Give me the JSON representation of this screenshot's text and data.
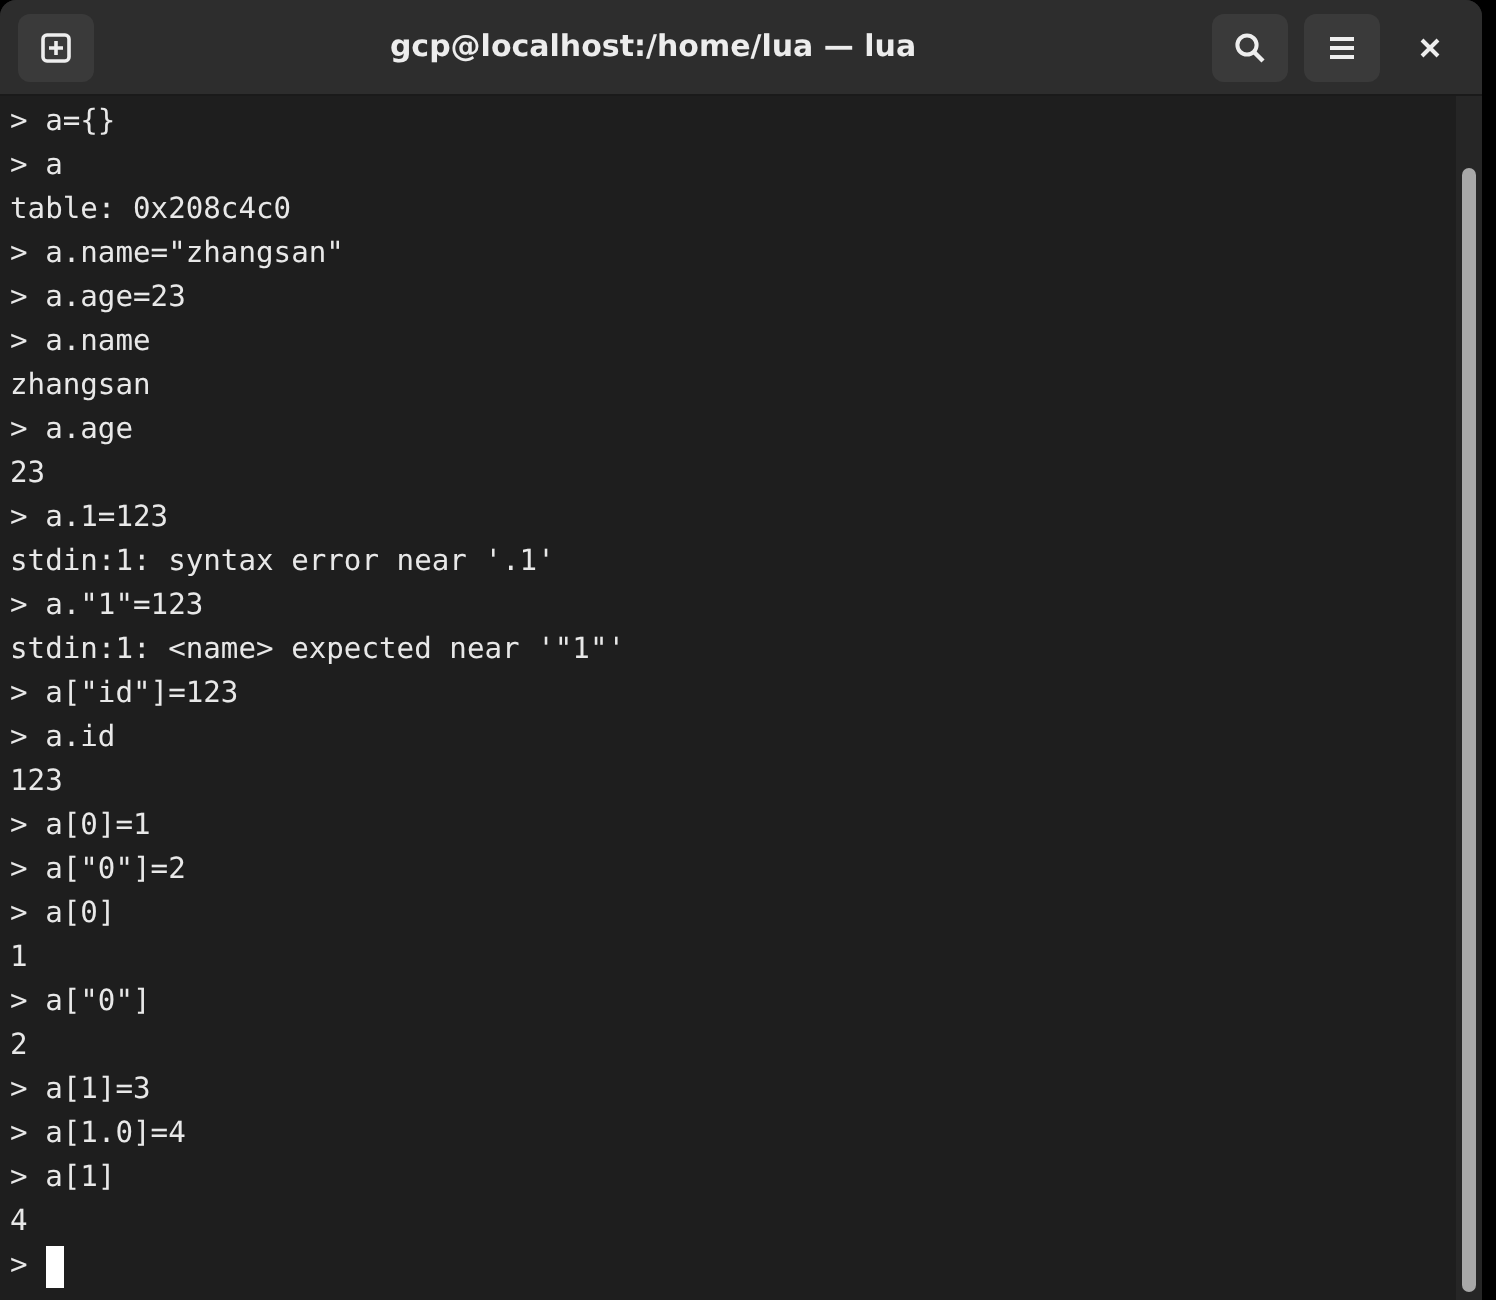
{
  "window": {
    "title": "gcp@localhost:/home/lua — lua"
  },
  "terminal": {
    "lines": [
      "> a={}",
      "> a",
      "table: 0x208c4c0",
      "> a.name=\"zhangsan\"",
      "> a.age=23",
      "> a.name",
      "zhangsan",
      "> a.age",
      "23",
      "> a.1=123",
      "stdin:1: syntax error near '.1'",
      "> a.\"1\"=123",
      "stdin:1: <name> expected near '\"1\"'",
      "> a[\"id\"]=123",
      "> a.id",
      "123",
      "> a[0]=1",
      "> a[\"0\"]=2",
      "> a[0]",
      "1",
      "> a[\"0\"]",
      "2",
      "> a[1]=3",
      "> a[1.0]=4",
      "> a[1]",
      "4"
    ],
    "prompt": ">",
    "cursor": true
  }
}
